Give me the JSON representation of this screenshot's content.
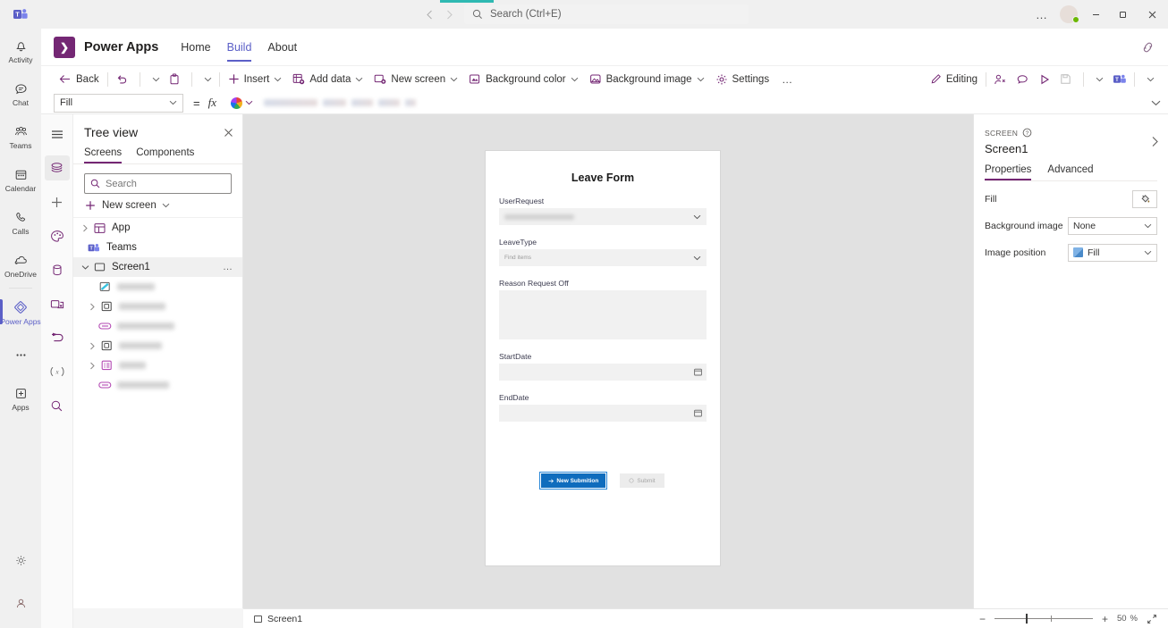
{
  "titlebar": {
    "back_icon": "chevron-left-icon",
    "forward_icon": "chevron-right-icon",
    "search_placeholder": "Search (Ctrl+E)",
    "more_label": "…",
    "minimize_label": "—",
    "maximize_label": "□",
    "close_label": "✕"
  },
  "teams_rail": {
    "items": [
      {
        "label": "Activity",
        "icon": "bell-icon"
      },
      {
        "label": "Chat",
        "icon": "chat-bubble-icon"
      },
      {
        "label": "Teams",
        "icon": "people-icon"
      },
      {
        "label": "Calendar",
        "icon": "calendar-icon"
      },
      {
        "label": "Calls",
        "icon": "phone-icon"
      },
      {
        "label": "OneDrive",
        "icon": "cloud-icon"
      },
      {
        "label": "Power Apps",
        "icon": "power-apps-icon",
        "active": true
      },
      {
        "label": "",
        "icon": "more-ellipsis-icon"
      },
      {
        "label": "Apps",
        "icon": "plus-box-icon"
      }
    ],
    "bottom": [
      {
        "label": "",
        "icon": "gear-icon"
      },
      {
        "label": "",
        "icon": "person-icon"
      }
    ]
  },
  "pa_header": {
    "logo_glyph": "❯",
    "title": "Power Apps",
    "nav": [
      {
        "label": "Home",
        "active": false
      },
      {
        "label": "Build",
        "active": true
      },
      {
        "label": "About",
        "active": false
      }
    ],
    "right_icon": "popout-link-icon"
  },
  "command_bar": {
    "back_label": "Back",
    "undo_icon": "undo-icon",
    "paste_icon": "paste-icon",
    "insert_label": "Insert",
    "add_data_label": "Add data",
    "new_screen_label": "New screen",
    "background_color_label": "Background color",
    "background_image_label": "Background image",
    "settings_label": "Settings",
    "overflow_label": "…",
    "editing_label": "Editing",
    "right_icons": [
      "share-person-icon",
      "comment-icon",
      "play-preview-icon",
      "save-icon",
      "chevron-down-icon",
      "teams-publish-icon",
      "chevron-down-icon"
    ]
  },
  "formula_bar": {
    "property": "Fill",
    "equals": "=",
    "fx": "fx",
    "swatch_icon": "color-wheel-icon",
    "formula_redacted": true,
    "expand_icon": "chevron-down-icon"
  },
  "studio_rail": {
    "items": [
      {
        "icon": "hamburger-menu-icon",
        "selected": false
      },
      {
        "icon": "tree-view-icon",
        "selected": true
      },
      {
        "icon": "insert-plus-icon",
        "selected": false
      },
      {
        "icon": "theme-palette-icon",
        "selected": false
      },
      {
        "icon": "data-cylinder-icon",
        "selected": false
      },
      {
        "icon": "media-icon",
        "selected": false
      },
      {
        "icon": "power-automate-icon",
        "selected": false
      },
      {
        "icon": "variables-icon",
        "selected": false
      },
      {
        "icon": "search-icon",
        "selected": false
      }
    ]
  },
  "tree_view": {
    "title": "Tree view",
    "close_icon": "close-icon",
    "tabs": [
      {
        "label": "Screens",
        "active": true
      },
      {
        "label": "Components",
        "active": false
      }
    ],
    "search_placeholder": "Search",
    "new_screen_label": "New screen",
    "rows": [
      {
        "label": "App",
        "icon": "app-icon",
        "chevron": "collapsed",
        "indent": 0,
        "selected": false,
        "redacted": false
      },
      {
        "label": "Teams",
        "icon": "teams-icon",
        "chevron": "none",
        "indent": 1,
        "selected": false,
        "redacted": false
      },
      {
        "label": "Screen1",
        "icon": "screen-icon",
        "chevron": "expanded",
        "indent": 0,
        "selected": true,
        "redacted": false,
        "more": "…"
      },
      {
        "label": "",
        "icon": "label-icon",
        "chevron": "none",
        "indent": 2,
        "selected": false,
        "redacted": true,
        "blur_width": 42
      },
      {
        "label": "",
        "icon": "container-icon",
        "chevron": "collapsed",
        "indent": 1,
        "selected": false,
        "redacted": true,
        "blur_width": 52
      },
      {
        "label": "",
        "icon": "textinput-icon",
        "chevron": "none",
        "indent": 2,
        "selected": false,
        "redacted": true,
        "blur_width": 64
      },
      {
        "label": "",
        "icon": "container-icon",
        "chevron": "collapsed",
        "indent": 1,
        "selected": false,
        "redacted": true,
        "blur_width": 48
      },
      {
        "label": "",
        "icon": "form-icon",
        "chevron": "collapsed",
        "indent": 1,
        "selected": false,
        "redacted": true,
        "blur_width": 30
      },
      {
        "label": "",
        "icon": "textinput-icon",
        "chevron": "none",
        "indent": 2,
        "selected": false,
        "redacted": true,
        "blur_width": 58
      }
    ]
  },
  "canvas_app": {
    "form_title": "Leave Form",
    "fields": [
      {
        "label": "UserRequest",
        "type": "combobox",
        "value_redacted": true,
        "placeholder": ""
      },
      {
        "label": "LeaveType",
        "type": "combobox",
        "value_redacted": false,
        "placeholder": "Find items"
      },
      {
        "label": "Reason Request Off",
        "type": "textarea",
        "value": ""
      },
      {
        "label": "StartDate",
        "type": "datepicker",
        "value": "",
        "icon": "calendar-icon"
      },
      {
        "label": "EndDate",
        "type": "datepicker",
        "value": "",
        "icon": "calendar-icon"
      }
    ],
    "buttons": [
      {
        "label": "New Submition",
        "style": "primary",
        "icon": "arrow-icon"
      },
      {
        "label": "Submit",
        "style": "disabled",
        "icon": "circle-icon"
      }
    ]
  },
  "properties_panel": {
    "kicker": "SCREEN",
    "help_icon": "question-circle-icon",
    "expand_icon": "chevron-right-icon",
    "name": "Screen1",
    "tabs": [
      {
        "label": "Properties",
        "active": true
      },
      {
        "label": "Advanced",
        "active": false
      }
    ],
    "rows": [
      {
        "label": "Fill",
        "control": "colorbutton",
        "value": "",
        "icon": "paint-bucket-icon"
      },
      {
        "label": "Background image",
        "control": "select",
        "value": "None"
      },
      {
        "label": "Image position",
        "control": "select",
        "value": "Fill",
        "thumb": true
      }
    ]
  },
  "status_bar": {
    "screen_label": "Screen1",
    "minus_label": "−",
    "plus_label": "+",
    "zoom_value": "50",
    "zoom_unit": "%",
    "fit_icon": "fit-screen-icon"
  },
  "colors": {
    "teams_bg": "#f0f0f0",
    "powerapps_purple": "#742774",
    "teams_accent": "#5b5fc7",
    "teal_tab": "#2fb9b2",
    "canvas_bg": "#e1e1e1",
    "primary_button": "#0f6cbd",
    "presence_green": "#6bb700"
  }
}
